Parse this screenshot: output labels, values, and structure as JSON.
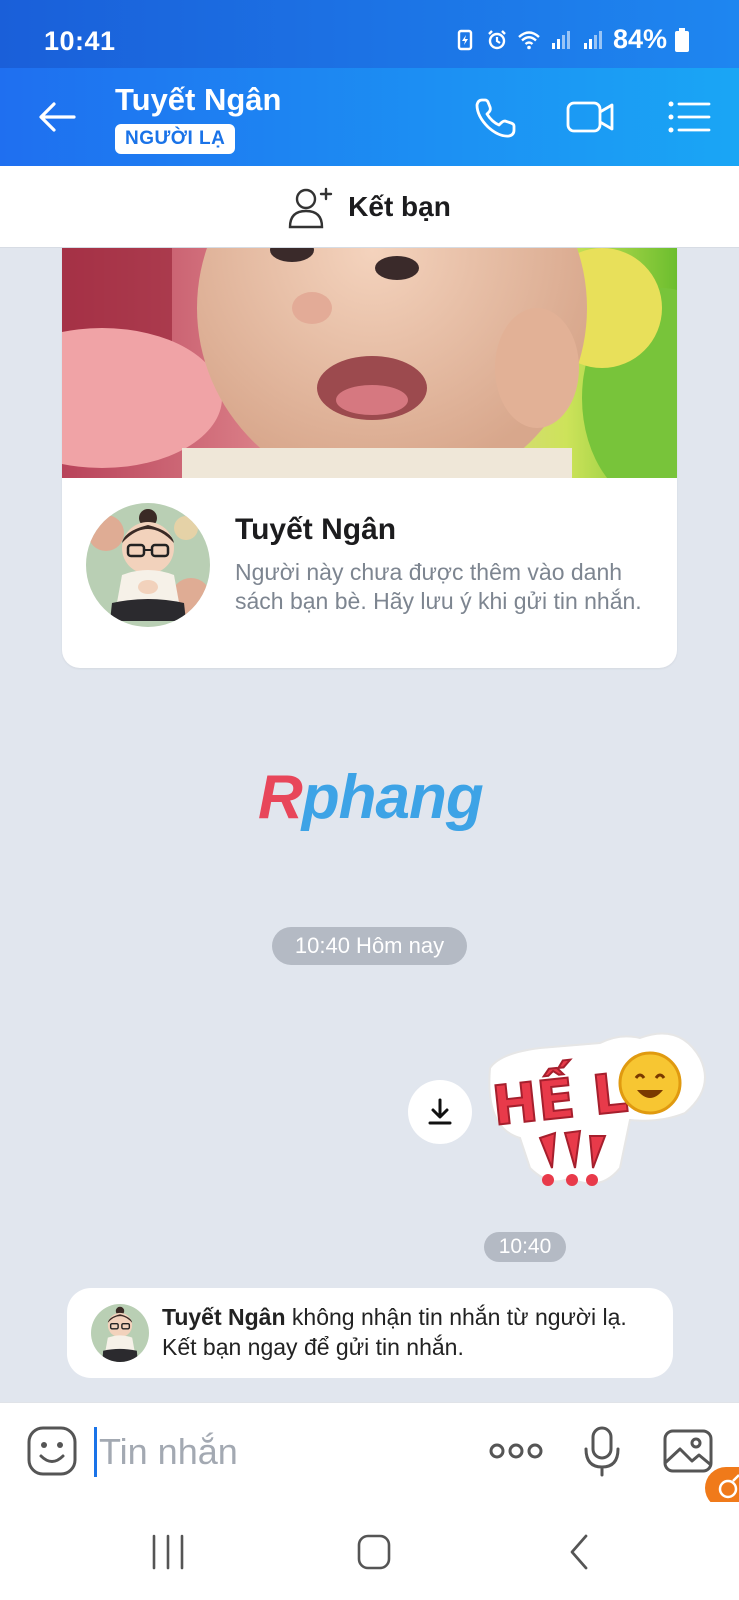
{
  "status_bar": {
    "time": "10:41",
    "battery": "84%"
  },
  "header": {
    "contact_name": "Tuyết Ngân",
    "badge": "NGƯỜI LẠ"
  },
  "add_friend": {
    "label": "Kết bạn"
  },
  "profile_card": {
    "name": "Tuyết Ngân",
    "description": "Người này chưa được thêm vào danh sách bạn bè. Hãy lưu ý khi gửi tin nhắn."
  },
  "watermark": {
    "first": "R",
    "rest": "phang"
  },
  "chat": {
    "date_separator": "10:40 Hôm nay",
    "sticker_time": "10:40",
    "sticker_text": "HẾ LÔ"
  },
  "notice": {
    "name": "Tuyết Ngân",
    "line1_rest": " không nhận tin nhắn từ người lạ.",
    "line2": "Kết bạn ngay để gửi tin nhắn."
  },
  "composer": {
    "placeholder": "Tin nhắn"
  },
  "colors": {
    "accent": "#1a73e8",
    "header_start": "#1f6ff0",
    "header_end": "#1aa6f5",
    "background": "#e1e6ee"
  },
  "icons": [
    "back-arrow-icon",
    "phone-icon",
    "video-call-icon",
    "menu-list-icon",
    "add-friend-icon",
    "download-icon",
    "emoji-icon",
    "more-icon",
    "mic-icon",
    "image-icon",
    "recent-apps-icon",
    "home-icon",
    "back-nav-icon"
  ]
}
